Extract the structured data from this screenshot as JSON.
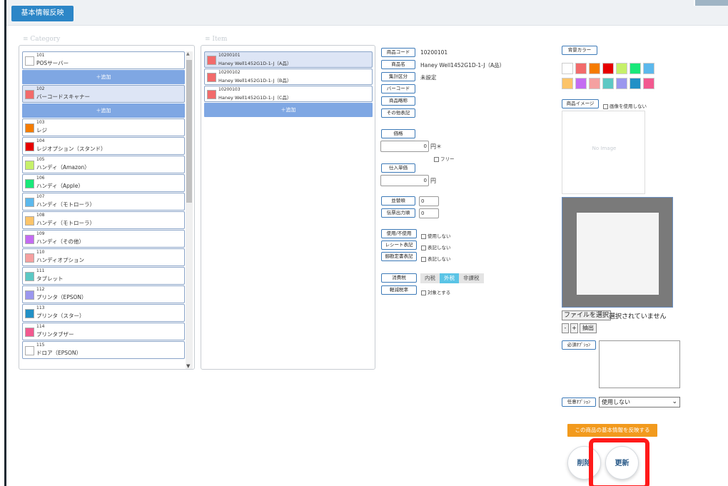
{
  "header": {
    "reflect_basic_label": "基本情報反映"
  },
  "category": {
    "heading": "≡ Category",
    "add_label": "＋追加",
    "items": [
      {
        "code": "101",
        "name": "POSサーバー",
        "color": "#ffffff"
      },
      {
        "code": "102",
        "name": "バーコードスキャナー",
        "color": "#f26b6b"
      },
      {
        "code": "103",
        "name": "レジ",
        "color": "#f57c00"
      },
      {
        "code": "104",
        "name": "レジオプション（スタンド）",
        "color": "#e60000"
      },
      {
        "code": "105",
        "name": "ハンディ（Amazon）",
        "color": "#c6f06a"
      },
      {
        "code": "106",
        "name": "ハンディ（Apple）",
        "color": "#19e87a"
      },
      {
        "code": "107",
        "name": "ハンディ（モトローラ）",
        "color": "#5cb8ec"
      },
      {
        "code": "108",
        "name": "ハンディ（モトローラ）",
        "color": "#fcc46a"
      },
      {
        "code": "109",
        "name": "ハンディ（その他）",
        "color": "#c46cf2"
      },
      {
        "code": "110",
        "name": "ハンディオプション",
        "color": "#f5a0a0"
      },
      {
        "code": "111",
        "name": "タブレット",
        "color": "#5cc8c4"
      },
      {
        "code": "112",
        "name": "プリンタ（EPSON）",
        "color": "#9b97ee"
      },
      {
        "code": "113",
        "name": "プリンタ（スター）",
        "color": "#2290c6"
      },
      {
        "code": "114",
        "name": "プリンタブザー",
        "color": "#f2598f"
      },
      {
        "code": "115",
        "name": "ドロア（EPSON）",
        "color": "#ffffff"
      }
    ]
  },
  "item": {
    "heading": "≡ Item",
    "add_label": "＋追加",
    "items": [
      {
        "code": "10200101",
        "name": "Haney Well1452G1D-1-J（A品）",
        "color": "#f26b6b"
      },
      {
        "code": "10200102",
        "name": "Haney Well1452G1D-1-J（B品）",
        "color": "#f26b6b"
      },
      {
        "code": "10200103",
        "name": "Haney Well1452G1D-1-J（C品）",
        "color": "#f26b6b"
      }
    ]
  },
  "detail": {
    "product_code_label": "商品コード",
    "product_code_value": "10200101",
    "product_name_label": "商品名",
    "product_name_value": "Haney Well1452G1D-1-J（A品）",
    "aggregate_label": "集計区分",
    "aggregate_value": "未設定",
    "barcode_label": "バーコード",
    "short_name_label": "商品略称",
    "other_label": "その他表記",
    "price_label": "価格",
    "price_value": "0",
    "price_unit": "円＊",
    "free_label": "フリー",
    "cost_label": "仕入単価",
    "cost_value": "0",
    "cost_unit": "円",
    "display_order_label": "並替順",
    "display_order_value": "0",
    "slip_order_label": "伝票出力順",
    "slip_order_value": "0",
    "use_label": "使用/不使用",
    "use_option": "使用しない",
    "receipt_label": "レシート表記",
    "receipt_option": "表記しない",
    "kitchen_label": "御勘定書表記",
    "kitchen_option": "表記しない",
    "tax_label": "消費税",
    "tax_options": [
      "内税",
      "外税",
      "非課税"
    ],
    "tax_selected": "外税",
    "reduced_label": "軽減税率",
    "reduced_option": "対象とする"
  },
  "right": {
    "bg_color_label": "背景カラー",
    "palette": [
      "#ffffff",
      "#f26b6b",
      "#f57c00",
      "#e60000",
      "#c6f06a",
      "#19e87a",
      "#5cb8ec",
      "#fcc46a",
      "#c46cf2",
      "#f5a0a0",
      "#5cc8c4",
      "#9b97ee",
      "#2290c6",
      "#f2598f"
    ],
    "image_label": "商品イメージ",
    "no_image_option": "画像を使用しない",
    "no_image_text": "No Image",
    "file_button": "ファイルを選択",
    "file_status": "選択されていません",
    "minus": "-",
    "plus": "+",
    "extract": "抽出",
    "required_option_label": "必須ｵﾌﾟｼｮﾝ",
    "optional_option_label": "任意ｵﾌﾟｼｮﾝ",
    "optional_select_value": "使用しない",
    "reflect_item_label": "この商品の基本情報を反映する",
    "delete_label": "削除",
    "update_label": "更新"
  }
}
